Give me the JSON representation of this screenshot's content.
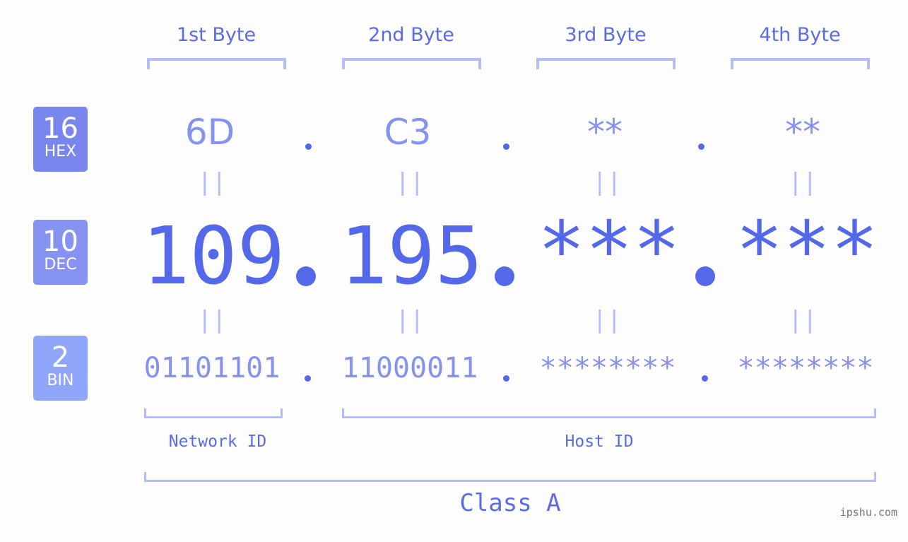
{
  "bytes": [
    {
      "label": "1st Byte",
      "hex": "6D",
      "dec": "109",
      "bin": "01101101"
    },
    {
      "label": "2nd Byte",
      "hex": "C3",
      "dec": "195",
      "bin": "11000011"
    },
    {
      "label": "3rd Byte",
      "hex": "**",
      "dec": "***",
      "bin": "********"
    },
    {
      "label": "4th Byte",
      "hex": "**",
      "dec": "***",
      "bin": "********"
    }
  ],
  "badges": {
    "hex": {
      "num": "16",
      "label": "HEX",
      "color": "#7886ee"
    },
    "dec": {
      "num": "10",
      "label": "DEC",
      "color": "#8693f2"
    },
    "bin": {
      "num": "2",
      "label": "BIN",
      "color": "#8fa6fb"
    }
  },
  "equals": "=",
  "network_id": "Network ID",
  "host_id": "Host ID",
  "class": "Class A",
  "watermark": "ipshu.com",
  "colors": {
    "accent": "#5468ea",
    "light": "#8593ef",
    "bracket": "#b4bdf9"
  }
}
